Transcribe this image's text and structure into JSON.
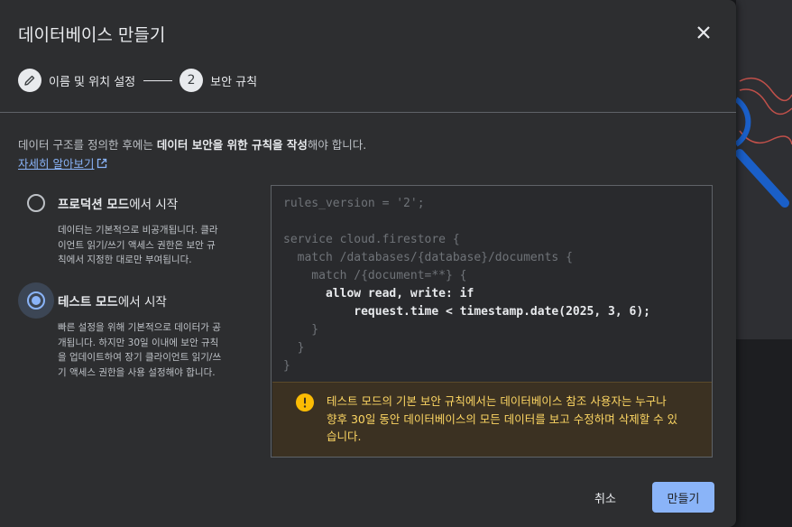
{
  "dialog": {
    "title": "데이터베이스 만들기",
    "close_icon": "close-icon"
  },
  "stepper": {
    "step1": {
      "label": "이름 및 위치 설정",
      "icon": "pencil-icon",
      "state": "completed"
    },
    "step2": {
      "number": "2",
      "label": "보안 규칙",
      "state": "active"
    }
  },
  "intro": {
    "text_before": "데이터 구조를 정의한 후에는 ",
    "text_bold": "데이터 보안을 위한 규칙을 작성",
    "text_after": "해야 합니다.",
    "learn_more": "자세히 알아보기",
    "learn_more_icon": "external-link-icon"
  },
  "options": {
    "production": {
      "label_bold": "프로덕션 모드",
      "label_rest": "에서 시작",
      "selected": false,
      "description": [
        "데이터는 기본적으로 비공개됩니다. 클라",
        "이언트 읽기/쓰기 액세스 권한은 보안 규",
        "칙에서 지정한 대로만 부여됩니다."
      ]
    },
    "test": {
      "label_bold": "테스트 모드",
      "label_rest": "에서 시작",
      "selected": true,
      "description": [
        "빠른 설정을 위해 기본적으로 데이터가 공",
        "개됩니다. 하지만 30일 이내에 보안 규칙",
        "을 업데이트하여 장기 클라이언트 읽기/쓰",
        "기 액세스 권한을 사용 설정해야 합니다."
      ]
    }
  },
  "rules_code": {
    "lines": [
      "rules_version = '2';",
      "",
      "service cloud.firestore {",
      "  match /databases/{database}/documents {",
      "    match /{document=**} {",
      "      allow read, write: if",
      "          request.time < timestamp.date(2025, 3, 6);",
      "    }",
      "  }",
      "}"
    ]
  },
  "warning": {
    "icon": "warning-icon",
    "lines": [
      "테스트 모드의 기본 보안 규칙에서는 데이터베이스 참조 사용자는 누구나",
      "향후 30일 동안 데이터베이스의 모든 데이터를 보고 수정하며 삭제할 수 있",
      "습니다."
    ]
  },
  "footer": {
    "cancel": "취소",
    "create": "만들기"
  },
  "colors": {
    "accent": "#8ab4f8",
    "warning_text": "#fdd663",
    "warning_bg": "#3b3122",
    "dialog_bg": "#2d2e30"
  }
}
